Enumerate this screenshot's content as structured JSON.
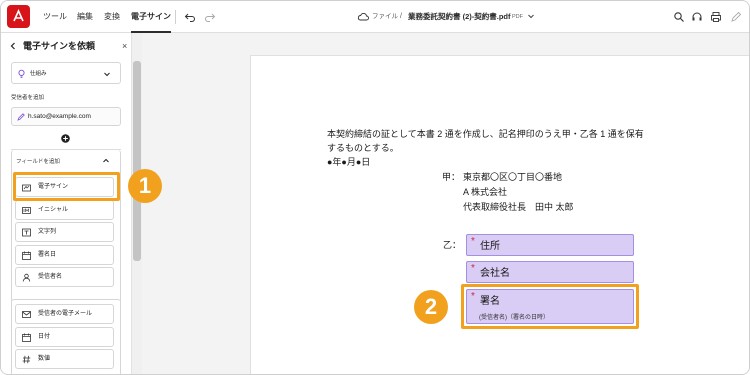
{
  "toolbar": {
    "menus": [
      "ツール",
      "編集",
      "変換",
      "電子サイン"
    ],
    "file_breadcrumb": "ファイル",
    "breadcrumb_sep": "/",
    "document_name": "業務委託契約書 (2)-契約書.pdf",
    "document_type": "PDF",
    "brand_color": "#d7141a"
  },
  "panel": {
    "title": "電子サインを依頼",
    "back_icon": "chevron-left-icon",
    "close_glyph": "×",
    "tips_label": "仕組み",
    "recipients_label": "受信者を追加",
    "recipient_email": "h.sato@example.com",
    "fields_section_label": "フィールドを追加",
    "fields": [
      {
        "label": "電子サイン",
        "icon": "signature-icon"
      },
      {
        "label": "イニシャル",
        "icon": "initials-icon"
      },
      {
        "label": "文字列",
        "icon": "text-field-icon"
      },
      {
        "label": "署名日",
        "icon": "calendar-icon"
      },
      {
        "label": "受信者名",
        "icon": "person-icon"
      }
    ],
    "fields2": [
      {
        "label": "受信者の電子メール",
        "icon": "mail-icon"
      },
      {
        "label": "日付",
        "icon": "calendar-icon"
      },
      {
        "label": "数値",
        "icon": "hash-icon"
      }
    ]
  },
  "document": {
    "line1": "本契約締結の証として本書 2 通を作成し、記名押印のうえ甲・乙各 1 通を保有",
    "line2": "するものとする。",
    "line3": "●年●月●日",
    "party_a_label": "甲：",
    "party_a_address": "東京都〇区〇丁目〇番地",
    "party_a_company": "A 株式会社",
    "party_a_rep": "代表取締役社長　田中 太郎",
    "party_b_label": "乙：",
    "field_address": "住所",
    "field_company": "会社名",
    "field_signature": "署名",
    "field_signature_sub": "(受信者名)（署名の日時）",
    "required_mark": "*"
  },
  "callouts": {
    "badge1": "1",
    "badge2": "2",
    "color": "#f2a11f"
  }
}
